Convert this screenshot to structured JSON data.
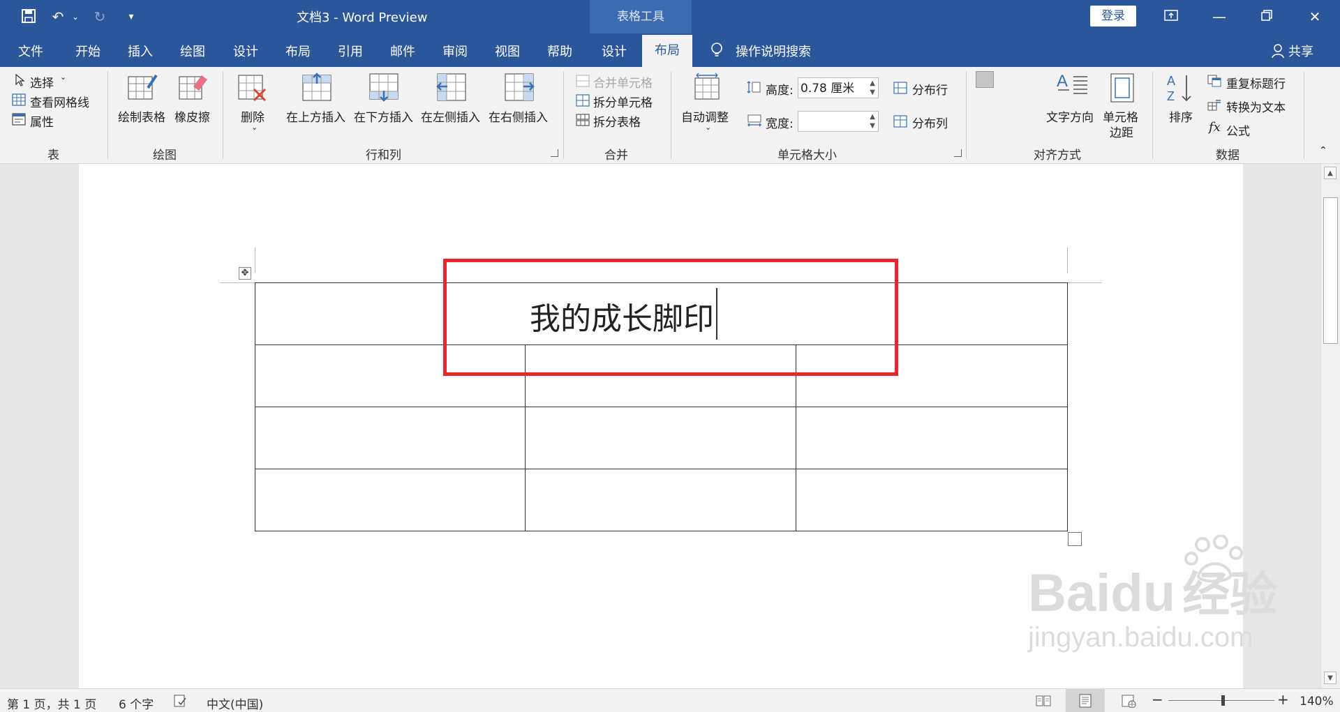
{
  "window": {
    "title": "文档3  -  Word Preview",
    "context_tab_group": "表格工具",
    "login_label": "登录",
    "share_label": "共享"
  },
  "tabs": [
    {
      "label": "文件"
    },
    {
      "label": "开始"
    },
    {
      "label": "插入"
    },
    {
      "label": "绘图"
    },
    {
      "label": "设计"
    },
    {
      "label": "布局"
    },
    {
      "label": "引用"
    },
    {
      "label": "邮件"
    },
    {
      "label": "审阅"
    },
    {
      "label": "视图"
    },
    {
      "label": "帮助"
    },
    {
      "label": "设计"
    },
    {
      "label": "布局",
      "active": true
    }
  ],
  "search": {
    "label": "操作说明搜索"
  },
  "ribbon": {
    "table_group": {
      "label": "表",
      "select": "选择",
      "view_gridlines": "查看网格线",
      "properties": "属性"
    },
    "draw_group": {
      "label": "绘图",
      "draw_table": "绘制表格",
      "eraser": "橡皮擦"
    },
    "rows_cols_group": {
      "label": "行和列",
      "delete": "删除",
      "insert_above": "在上方插入",
      "insert_below": "在下方插入",
      "insert_left": "在左侧插入",
      "insert_right": "在右侧插入"
    },
    "merge_group": {
      "label": "合并",
      "merge_cells": "合并单元格",
      "split_cells": "拆分单元格",
      "split_table": "拆分表格"
    },
    "cell_size_group": {
      "label": "单元格大小",
      "autofit": "自动调整",
      "height_label": "高度:",
      "height_value": "0.78 厘米",
      "width_label": "宽度:",
      "width_value": "",
      "distribute_rows": "分布行",
      "distribute_cols": "分布列"
    },
    "alignment_group": {
      "label": "对齐方式",
      "text_direction": "文字方向",
      "cell_margins_line1": "单元格",
      "cell_margins_line2": "边距"
    },
    "data_group": {
      "label": "数据",
      "sort": "排序",
      "repeat_header": "重复标题行",
      "convert_to_text": "转换为文本",
      "formula": "公式"
    }
  },
  "document": {
    "table_title": "我的成长脚印",
    "rows": 4,
    "columns": 3
  },
  "statusbar": {
    "page": "第 1 页，共 1 页",
    "words": "6 个字",
    "language": "中文(中国)",
    "zoom": "140%"
  },
  "watermark": {
    "line1": "Bai",
    "line2": "du",
    "line3": "经验",
    "url": "jingyan.baidu.com"
  },
  "colors": {
    "accent": "#2b579a",
    "highlight_box": "#e8262b"
  }
}
